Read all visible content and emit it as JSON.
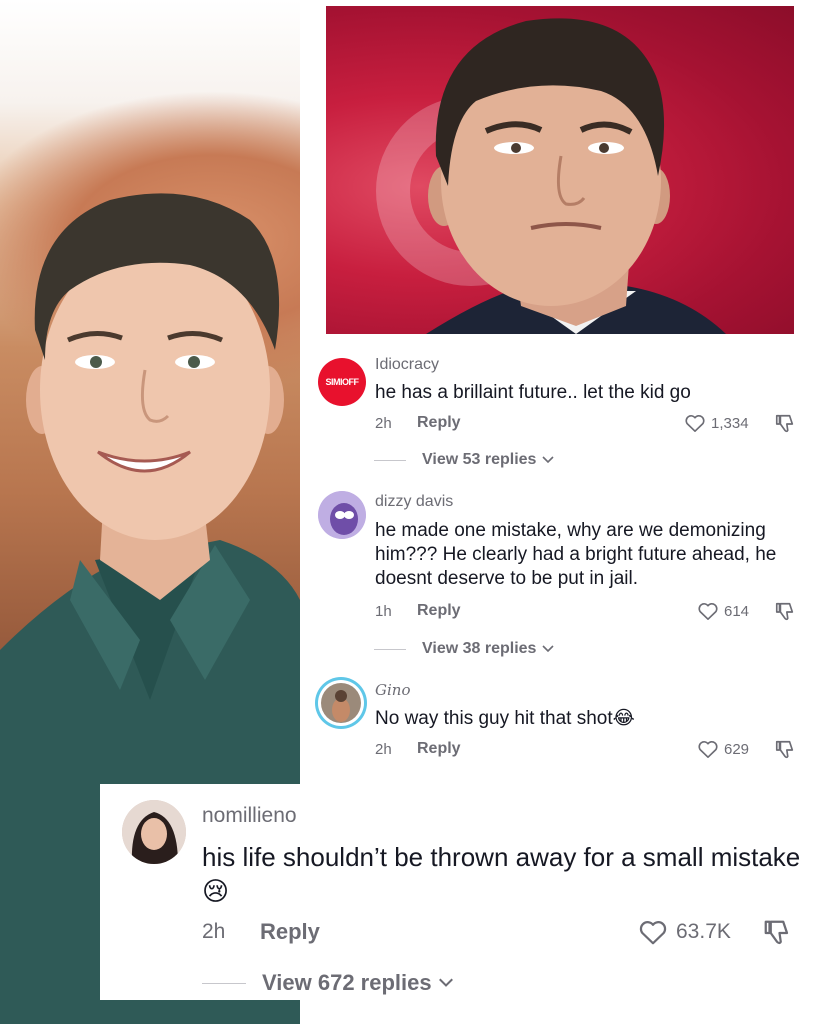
{
  "comments": [
    {
      "username": "Idiocracy",
      "avatar_text": "SIMIOFF",
      "text": "he has a brillaint future.. let the kid go",
      "time": "2h",
      "reply_label": "Reply",
      "likes": "1,334",
      "view_replies": "View 53 replies"
    },
    {
      "username": "dizzy davis",
      "text": "he made one mistake, why are we demonizing him??? He clearly had a bright future ahead, he doesnt deserve to be put in jail.",
      "time": "1h",
      "reply_label": "Reply",
      "likes": "614",
      "view_replies": "View 38 replies"
    },
    {
      "username": "Gino",
      "text": "No way this guy hit that shot😂",
      "time": "2h",
      "reply_label": "Reply",
      "likes": "629"
    }
  ],
  "featured_comment": {
    "username": "nomillieno",
    "text": "his life shouldn’t be thrown away for a small mistake😢",
    "time": "2h",
    "reply_label": "Reply",
    "likes": "63.7K",
    "view_replies": "View 672 replies"
  },
  "colors": {
    "brand_red": "#e8112d",
    "muted_text": "#6c6c74",
    "primary_text": "#161823"
  },
  "icons": [
    "heart-icon",
    "dislike-icon",
    "chevron-down-icon"
  ]
}
